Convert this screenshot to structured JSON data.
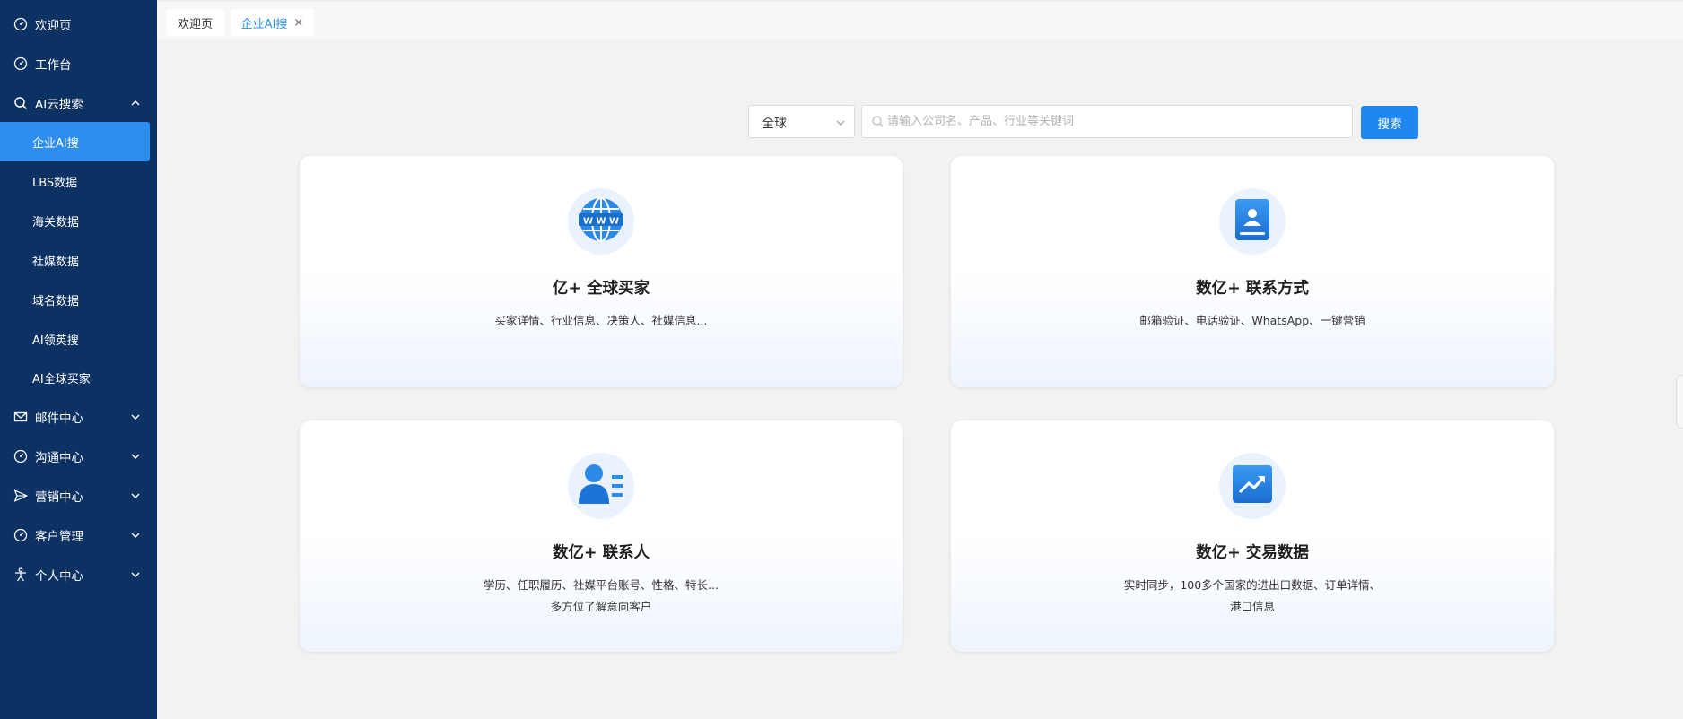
{
  "tabs": [
    {
      "label": "欢迎页"
    },
    {
      "label": "企业AI搜",
      "close": "×"
    }
  ],
  "sidebar": {
    "items": [
      {
        "label": "欢迎页",
        "icon": "dashboard-icon"
      },
      {
        "label": "工作台",
        "icon": "dashboard-icon"
      },
      {
        "label": "AI云搜索",
        "icon": "search-icon",
        "expanded": true
      },
      {
        "label": "邮件中心",
        "icon": "mail-icon"
      },
      {
        "label": "沟通中心",
        "icon": "dashboard-icon"
      },
      {
        "label": "营销中心",
        "icon": "send-icon"
      },
      {
        "label": "客户管理",
        "icon": "dashboard-icon"
      },
      {
        "label": "个人中心",
        "icon": "person-icon"
      }
    ],
    "subitems": [
      {
        "label": "企业AI搜",
        "active": true
      },
      {
        "label": "LBS数据"
      },
      {
        "label": "海关数据"
      },
      {
        "label": "社媒数据"
      },
      {
        "label": "域名数据"
      },
      {
        "label": "AI领英搜"
      },
      {
        "label": "AI全球买家"
      }
    ]
  },
  "search": {
    "region": "全球",
    "placeholder": "请输入公司名、产品、行业等关键词",
    "button": "搜索"
  },
  "cards": [
    {
      "title": "亿+ 全球买家",
      "desc1": "买家详情、行业信息、决策人、社媒信息...",
      "desc2": "",
      "icon": "globe-www-icon"
    },
    {
      "title": "数亿+ 联系方式",
      "desc1": "邮箱验证、电话验证、WhatsApp、一键营销",
      "desc2": "",
      "icon": "contact-book-icon"
    },
    {
      "title": "数亿+ 联系人",
      "desc1": "学历、任职履历、社媒平台账号、性格、特长...",
      "desc2": "多方位了解意向客户",
      "icon": "person-list-icon"
    },
    {
      "title": "数亿+ 交易数据",
      "desc1": "实时同步，100多个国家的进出口数据、订单详情、",
      "desc2": "港口信息",
      "icon": "trend-chart-icon"
    }
  ],
  "colors": {
    "sidebar_bg": "#0c3163",
    "accent": "#2e8ef0",
    "button": "#1e88f0"
  }
}
